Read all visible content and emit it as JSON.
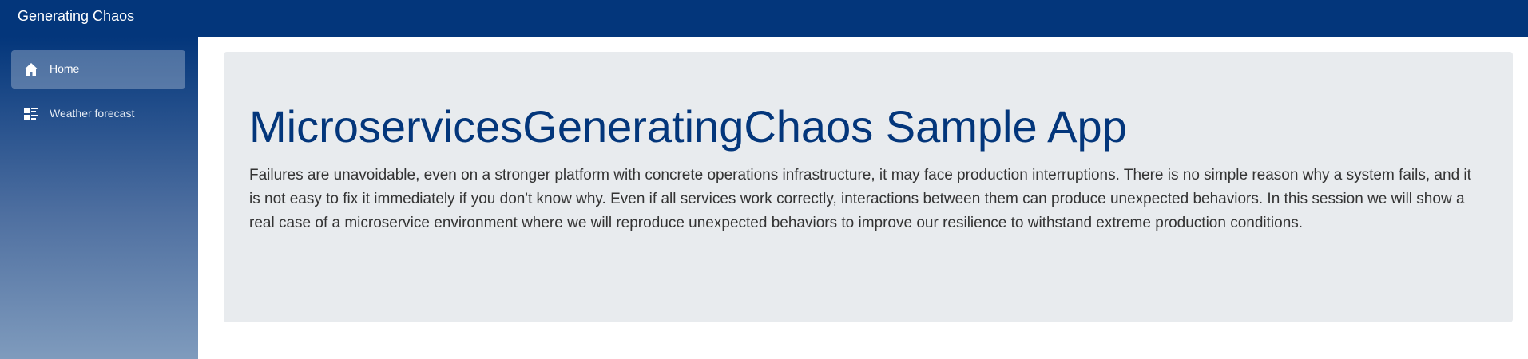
{
  "app": {
    "brand": "Generating Chaos"
  },
  "sidebar": {
    "items": [
      {
        "label": "Home",
        "icon": "home-icon",
        "active": true
      },
      {
        "label": "Weather forecast",
        "icon": "list-icon",
        "active": false
      }
    ]
  },
  "main": {
    "title": "MicroservicesGeneratingChaos Sample App",
    "body": "Failures are unavoidable, even on a stronger platform with concrete operations infrastructure, it may face production interruptions. There is no simple reason why a system fails, and it is not easy to fix it immediately if you don't know why. Even if all services work correctly, interactions between them can produce unexpected behaviors. In this session we will show a real case of a microservice environment where we will reproduce unexpected behaviors to improve our resilience to withstand extreme production conditions."
  },
  "colors": {
    "topbar": "#03367b",
    "title": "#03367b",
    "jumbotron": "#e8ebee"
  }
}
